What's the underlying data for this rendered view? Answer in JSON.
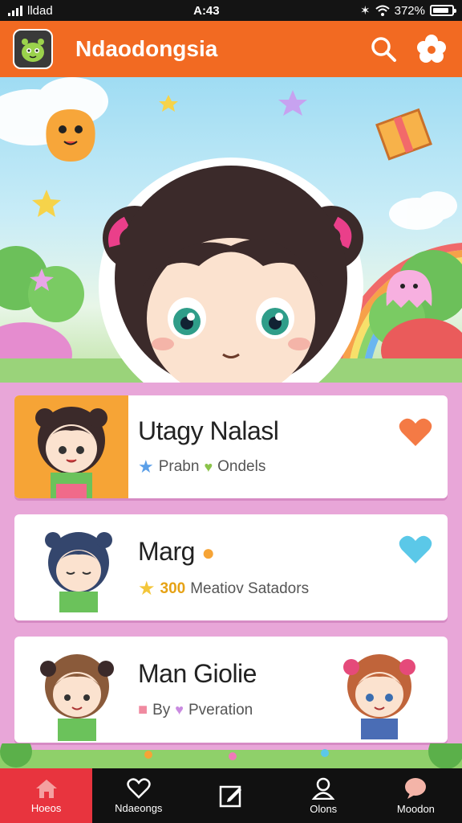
{
  "status": {
    "carrier": "lldad",
    "time": "A:43",
    "battery": "372%",
    "battery_fraction": 0.85
  },
  "app": {
    "title": "Ndaodongsia"
  },
  "cards": [
    {
      "title": "Utagy Nalasl",
      "meta1": "Prabn",
      "meta2": "Ondels",
      "heart_color": "#f47a45"
    },
    {
      "title": "Marg",
      "number": "300",
      "meta2": "Meatiov Satadors",
      "heart_color": "#5bc8e8"
    },
    {
      "title": "Man Giolie",
      "meta1": "By",
      "meta2": "Pveration",
      "heart_color": "#ffffff"
    }
  ],
  "tabs": [
    {
      "label": "Hoeos",
      "icon": "home-icon",
      "active": true
    },
    {
      "label": "Ndaeongs",
      "icon": "heart-icon",
      "active": false
    },
    {
      "label": "",
      "icon": "edit-icon",
      "active": false
    },
    {
      "label": "Olons",
      "icon": "user-icon",
      "active": false
    },
    {
      "label": "Moodon",
      "icon": "chat-icon",
      "active": false
    }
  ],
  "colors": {
    "accent": "#f26a22",
    "tab_active": "#e8343e",
    "card_bg": "#e8a6d8"
  }
}
